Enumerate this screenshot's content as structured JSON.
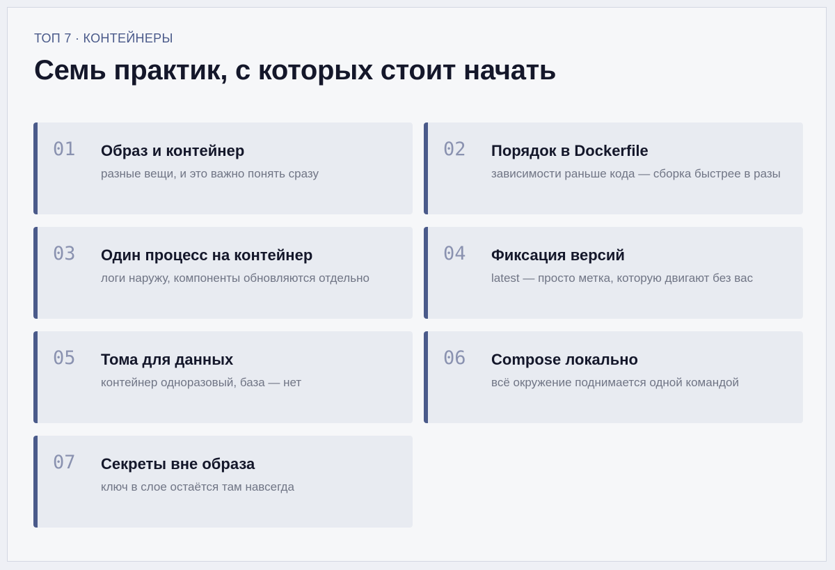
{
  "header": {
    "kicker": "ТОП 7 · КОНТЕЙНЕРЫ",
    "title": "Семь практик, с которых стоит начать"
  },
  "colors": {
    "accent": "#4a5a8a",
    "card_bg": "#e8ebf1",
    "page_bg": "#f6f7f9",
    "number": "#8a92b0",
    "title_text": "#14172a",
    "desc_text": "#707585"
  },
  "items": [
    {
      "num": "01",
      "title": "Образ и контейнер",
      "desc": "разные вещи, и это важно понять сразу"
    },
    {
      "num": "02",
      "title": "Порядок в Dockerfile",
      "desc": "зависимости раньше кода — сборка быстрее в разы"
    },
    {
      "num": "03",
      "title": "Один процесс на контейнер",
      "desc": "логи наружу, компоненты обновляются отдельно"
    },
    {
      "num": "04",
      "title": "Фиксация версий",
      "desc": "latest — просто метка, которую двигают без вас"
    },
    {
      "num": "05",
      "title": "Тома для данных",
      "desc": "контейнер одноразовый, база — нет"
    },
    {
      "num": "06",
      "title": "Compose локально",
      "desc": "всё окружение поднимается одной командой"
    },
    {
      "num": "07",
      "title": "Секреты вне образа",
      "desc": "ключ в слое остаётся там навсегда"
    }
  ]
}
